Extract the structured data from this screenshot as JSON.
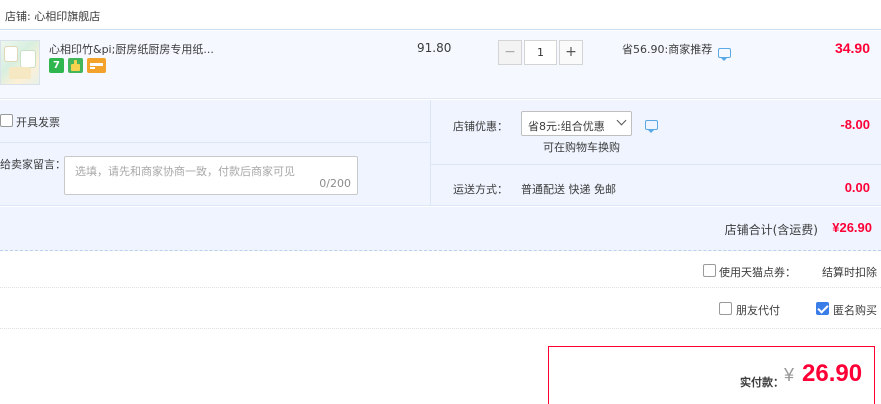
{
  "shop": {
    "label": "店铺: 心相印旗舰店"
  },
  "item": {
    "title": "心相印竹&pi;厨房纸厨房专用纸...",
    "badges": [
      {
        "icon": "seven-day-return-badge",
        "text": "7",
        "color": "#2fb64e"
      },
      {
        "icon": "gift-badge",
        "color": "#44b55a"
      },
      {
        "icon": "card-badge",
        "color": "#f3a32c"
      }
    ],
    "unit_price": "91.80",
    "quantity": "1",
    "quantity_minus": "−",
    "quantity_plus": "+",
    "promo": "省56.90:商家推荐",
    "subtotal": "34.90"
  },
  "options": {
    "invoice_label": "开具发票",
    "invoice_checked": false,
    "message_label": "给卖家留言：",
    "message_placeholder": "选填，请先和商家协商一致，付款后商家可见",
    "message_counter": "0/200",
    "discount_label": "店铺优惠：",
    "discount_selected": "省8元:组合优惠",
    "discount_sub": "可在购物车换购",
    "discount_amount": "-8.00",
    "shipping_label": "运送方式：",
    "shipping_value": "普通配送 快递 免邮",
    "shipping_amount": "0.00"
  },
  "store_total": {
    "label": "店铺合计(含运费)",
    "amount": "¥26.90"
  },
  "coupon": {
    "label": "使用天猫点券：",
    "value": "结算时扣除",
    "checked": false
  },
  "payment": {
    "friend_label": "朋友代付",
    "friend_checked": false,
    "anonymous_label": "匿名购买",
    "anonymous_checked": true
  },
  "final": {
    "label": "实付款：",
    "currency": "¥",
    "amount": "26.90"
  },
  "colors": {
    "accent_red": "#ff0036",
    "panel_blue": "#eff4ff",
    "checkbox_blue": "#3b7de8",
    "chat_blue": "#5aa9e6"
  }
}
